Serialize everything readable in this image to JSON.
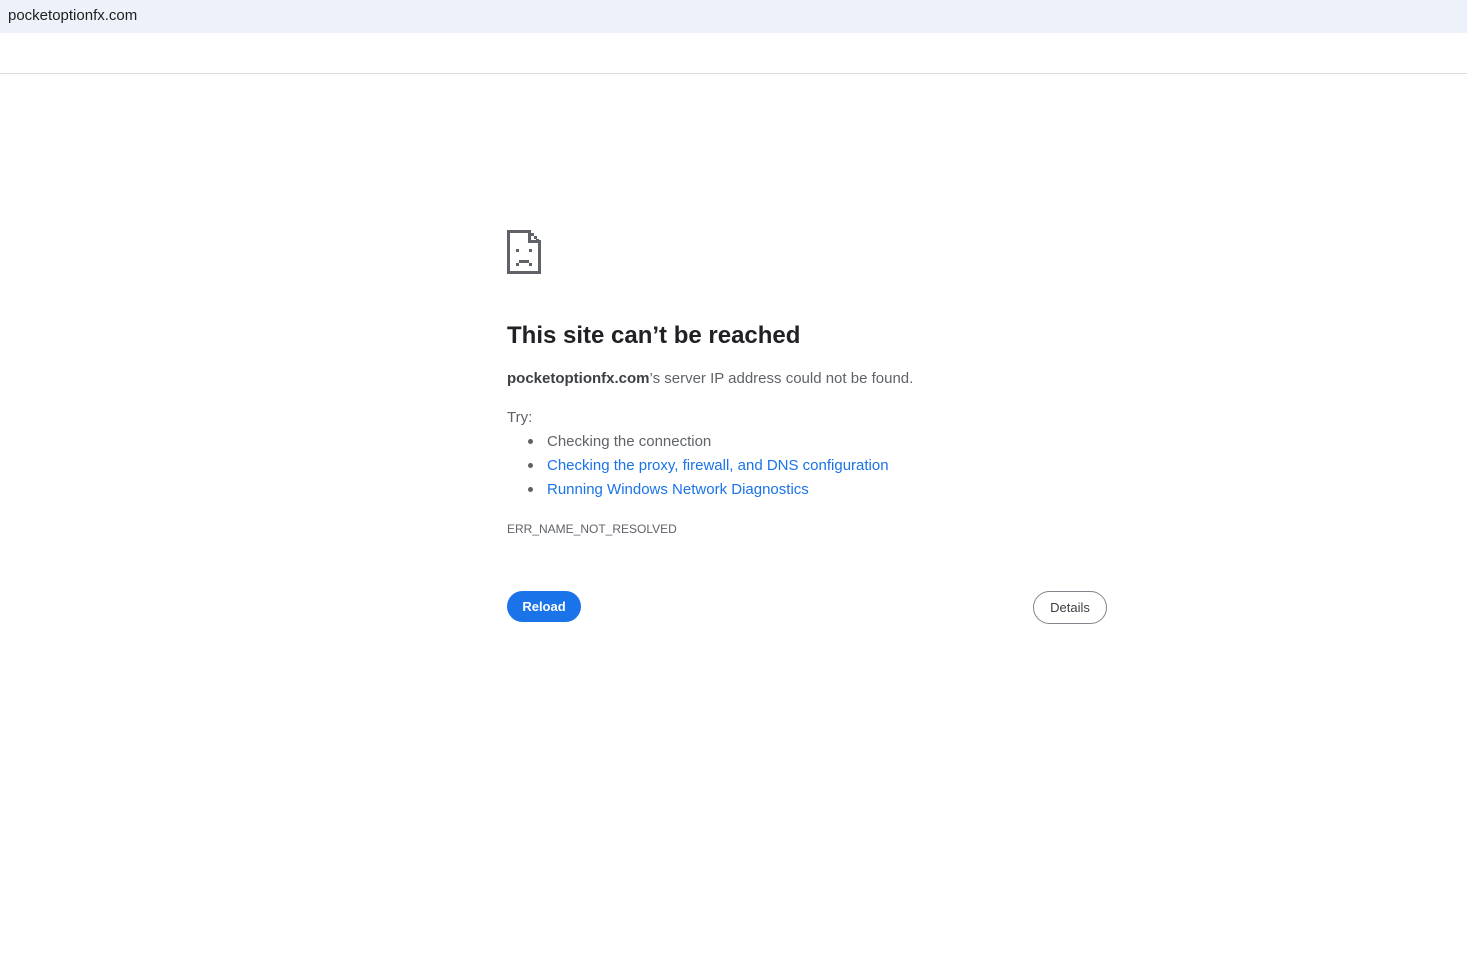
{
  "browser": {
    "url": "pocketoptionfx.com"
  },
  "error_page": {
    "icon": "sad-page-icon",
    "title": "This site can’t be reached",
    "host": "pocketoptionfx.com",
    "description_suffix": "’s server IP address could not be found.",
    "try_label": "Try:",
    "suggestions": [
      {
        "text": "Checking the connection",
        "is_link": false
      },
      {
        "text": "Checking the proxy, firewall, and DNS configuration",
        "is_link": true
      },
      {
        "text": "Running Windows Network Diagnostics",
        "is_link": true
      }
    ],
    "error_code": "ERR_NAME_NOT_RESOLVED",
    "reload_label": "Reload",
    "details_label": "Details"
  },
  "colors": {
    "accent": "#1a73e8",
    "text_primary": "#202124",
    "text_secondary": "#5f6368",
    "url_bar_bg": "#edf2fa"
  }
}
